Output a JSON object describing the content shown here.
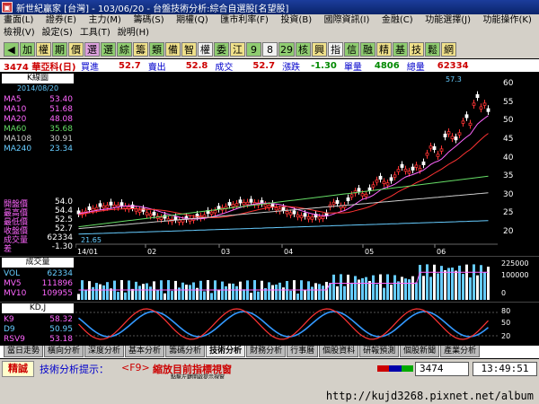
{
  "window": {
    "title": "新世紀贏家 [台灣] - 103/06/20 - 台盤技術分析:綜合自選股[名望股]"
  },
  "menu": {
    "row1": [
      "畫面(L)",
      "證券(E)",
      "主力(M)",
      "籌碼(S)",
      "期權(Q)",
      "匯市利率(F)",
      "投資(B)",
      "國際資訊(I)",
      "金融(C)",
      "功能選擇(J)",
      "功能操作(K)"
    ],
    "row2": [
      "檢視(V)",
      "設定(S)",
      "工具(T)",
      "說明(H)"
    ]
  },
  "toolbar": [
    {
      "t": "◀",
      "c": "g"
    },
    {
      "t": "加",
      "c": "g"
    },
    {
      "t": "權",
      "c": "y"
    },
    {
      "t": "期",
      "c": "g"
    },
    {
      "t": "價",
      "c": "y"
    },
    {
      "t": "選",
      "c": "p"
    },
    {
      "t": "選",
      "c": "g"
    },
    {
      "t": "綜",
      "c": "g"
    },
    {
      "t": "籌",
      "c": "y"
    },
    {
      "t": "類",
      "c": "g"
    },
    {
      "t": "備",
      "c": "y"
    },
    {
      "t": "智",
      "c": "y"
    },
    {
      "t": "權",
      "c": "w"
    },
    {
      "t": "委",
      "c": "g"
    },
    {
      "t": "江",
      "c": "y"
    },
    {
      "t": "9",
      "c": "g"
    },
    {
      "t": "8",
      "c": "w"
    },
    {
      "t": "29",
      "c": "g"
    },
    {
      "t": "核",
      "c": "g"
    },
    {
      "t": "興",
      "c": "y"
    },
    {
      "t": "指",
      "c": "w"
    },
    {
      "t": "信",
      "c": "g"
    },
    {
      "t": "融",
      "c": "g"
    },
    {
      "t": "精",
      "c": "y"
    },
    {
      "t": "基",
      "c": "g"
    },
    {
      "t": "技",
      "c": "y"
    },
    {
      "t": "鬆",
      "c": "g"
    },
    {
      "t": "網",
      "c": "y"
    }
  ],
  "info": {
    "code": "3474 華亞科(日)",
    "buy_label": "買進",
    "buy": "52.7",
    "sell_label": "賣出",
    "sell": "52.8",
    "deal_label": "成交",
    "deal": "52.7",
    "chg_label": "漲跌",
    "chg": "-1.30",
    "single_label": "單量",
    "single": "4806",
    "total_label": "總量",
    "total": "62334"
  },
  "kline": {
    "title": "K線圖",
    "date": "2014/08/20",
    "ma": [
      {
        "label": "MA5",
        "value": "53.40",
        "color": "#ff66ff"
      },
      {
        "label": "MA10",
        "value": "51.68",
        "color": "#ff66ff"
      },
      {
        "label": "MA20",
        "value": "48.08",
        "color": "#ff66ff"
      },
      {
        "label": "MA60",
        "value": "35.68",
        "color": "#66dd66"
      },
      {
        "label": "MA108",
        "value": "30.91",
        "color": "#cccccc"
      },
      {
        "label": "MA240",
        "value": "23.34",
        "color": "#66ccff"
      }
    ],
    "stats": [
      {
        "label": "開盤價",
        "value": "54.0"
      },
      {
        "label": "最高價",
        "value": "54.4"
      },
      {
        "label": "最低價",
        "value": "52.5"
      },
      {
        "label": "收盤價",
        "value": "52.7"
      },
      {
        "label": "成交量",
        "value": "62334"
      },
      {
        "label": "差",
        "value": "-1.30"
      }
    ],
    "high_mark": "57.3",
    "low_mark": "21.65",
    "right_ticks": [
      "60",
      "55",
      "50",
      "45",
      "40",
      "35",
      "30",
      "25",
      "20"
    ],
    "x_ticks": [
      "14/01",
      "02",
      "03",
      "04",
      "05",
      "06"
    ]
  },
  "volume": {
    "title": "成交量",
    "items": [
      {
        "label": "VOL",
        "value": "62334",
        "color": "#66ccff"
      },
      {
        "label": "MV5",
        "value": "111896",
        "color": "#ff66ff"
      },
      {
        "label": "MV10",
        "value": "109955",
        "color": "#ff66ff"
      }
    ],
    "right_ticks": [
      "225000",
      "100000",
      "0"
    ]
  },
  "kd": {
    "title": "KD,J",
    "items": [
      {
        "label": "K9",
        "value": "58.32",
        "color": "#ff66ff"
      },
      {
        "label": "D9",
        "value": "50.95",
        "color": "#66ccff"
      },
      {
        "label": "RSV9",
        "value": "53.18",
        "color": "#ff66ff"
      }
    ],
    "right_ticks": [
      "80",
      "50",
      "20"
    ]
  },
  "tabs": [
    "當日走勢",
    "橫向分析",
    "深度分析",
    "基本分析",
    "籌碼分析",
    "技術分析",
    "財務分析",
    "行事曆",
    "個股資料",
    "研報預測",
    "個股新聞",
    "產業分析"
  ],
  "active_tab": "技術分析",
  "status": {
    "mode": "精誠",
    "hint_label": "技術分析提示：",
    "hint_key": "<F9>",
    "hint_text": "縮放目前指標視窗",
    "sub_hint": "點擊左鍵開啟提示視窗",
    "code": "3474",
    "time": "13:49:51"
  },
  "url": "http://kujd3268.pixnet.net/album"
}
